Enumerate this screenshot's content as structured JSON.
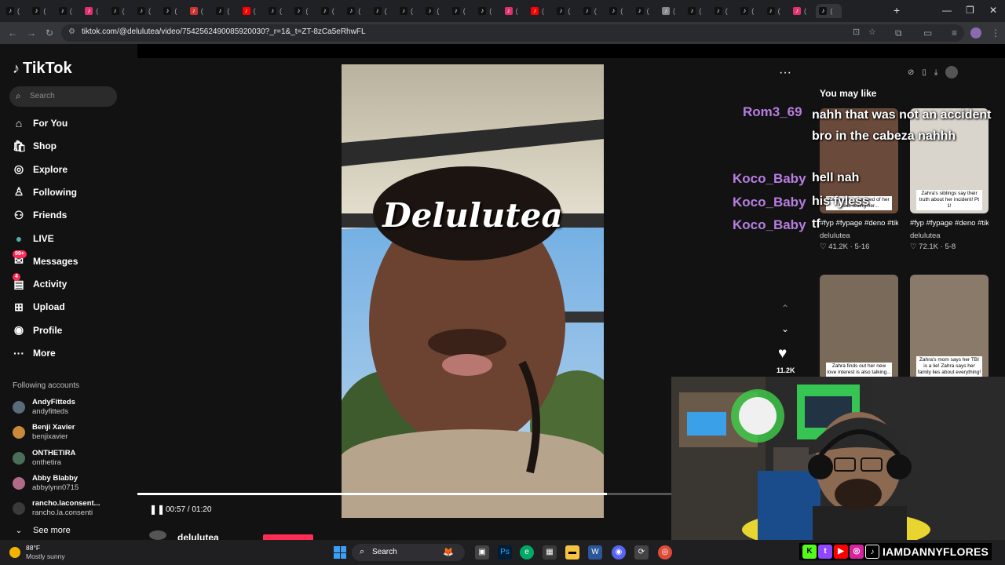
{
  "browser": {
    "url": "tiktok.com/@delulutea/video/7542562490085920030?_r=1&_t=ZT-8zCa5eRhwFL",
    "new_tab": "+"
  },
  "sidebar": {
    "logo": "TikTok",
    "search_placeholder": "Search",
    "nav": [
      {
        "label": "For You",
        "icon": "home-icon"
      },
      {
        "label": "Shop",
        "icon": "shop-icon"
      },
      {
        "label": "Explore",
        "icon": "compass-icon"
      },
      {
        "label": "Following",
        "icon": "following-icon"
      },
      {
        "label": "Friends",
        "icon": "friends-icon"
      },
      {
        "label": "LIVE",
        "icon": "live-icon"
      },
      {
        "label": "Messages",
        "icon": "messages-icon",
        "badge": "99+"
      },
      {
        "label": "Activity",
        "icon": "activity-icon",
        "badge": "4"
      },
      {
        "label": "Upload",
        "icon": "upload-icon"
      },
      {
        "label": "Profile",
        "icon": "profile-icon"
      },
      {
        "label": "More",
        "icon": "more-icon"
      }
    ],
    "following_header": "Following accounts",
    "accounts": [
      {
        "name": "AndyFitteds",
        "handle": "andyfitteds"
      },
      {
        "name": "Benji Xavier",
        "handle": "benjixavier"
      },
      {
        "name": "ONTHETIRA",
        "handle": "onthetira"
      },
      {
        "name": "Abby Blabby",
        "handle": "abbylynn0715"
      },
      {
        "name": "rancho.laconsent...",
        "handle": "rancho.la.consenti"
      }
    ],
    "see_more": "See more"
  },
  "player": {
    "overlay_title": "Delulutea",
    "time": "00:57 / 01:20",
    "progress": 0.88,
    "likes": "11.2K",
    "author_peek": "delulutea"
  },
  "chat": [
    {
      "user": "Rom3_69",
      "text": "nahh that was not an accident bro in the cabeza nahhh"
    },
    {
      "user": "Koco_Baby",
      "text": "hell nah"
    },
    {
      "user": "Koco_Baby",
      "text": "his fyless"
    },
    {
      "user": "Koco_Baby",
      "text": "tf"
    }
  ],
  "recommendations": {
    "header": "You may like",
    "items": [
      {
        "caption": "#fyp #fypage #deno #tiktoktea #delulu...",
        "author": "delulutea",
        "likes": "41.2K",
        "date": "5-16",
        "thumb_text": "Zahra says she tired of her sister telling her..."
      },
      {
        "caption": "#fyp #fypage #deno #tiktoktea #delulu...",
        "author": "delulutea",
        "likes": "72.1K",
        "date": "5-8",
        "thumb_text": "Zahra's siblings say their truth about her incident! Pt 1!"
      },
      {
        "caption": "",
        "author": "",
        "likes": "",
        "date": "",
        "thumb_text": "Zahra finds out her new love interest is also talking..."
      },
      {
        "caption": "",
        "author": "",
        "likes": "",
        "date": "",
        "thumb_text": "Zahra's mom says her TBI is a lie! Zahra says her family lies about everything!"
      }
    ]
  },
  "taskbar": {
    "weather_temp": "88°F",
    "weather_desc": "Mostly sunny",
    "search": "Search"
  },
  "stream": {
    "social_handle": "IAMDANNYFLORES"
  },
  "colors": {
    "tiktok_red": "#fe2c55",
    "chat_username": "#b77ee0"
  }
}
